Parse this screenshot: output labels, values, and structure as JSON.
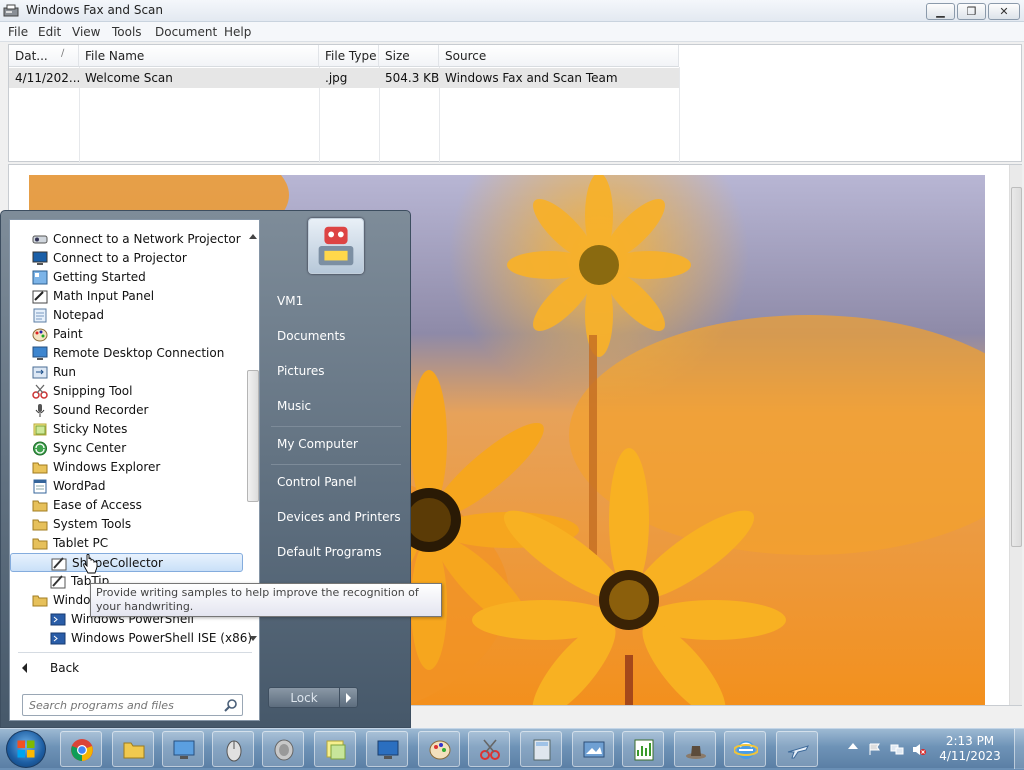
{
  "window": {
    "title": "Windows Fax and Scan",
    "menu": [
      "File",
      "Edit",
      "View",
      "Tools",
      "Document",
      "Help"
    ]
  },
  "list": {
    "columns": [
      "Dat...",
      "File Name",
      "File Type",
      "Size",
      "Source"
    ],
    "rows": [
      {
        "date": "4/11/202...",
        "file_name": "Welcome Scan",
        "file_type": ".jpg",
        "size": "504.3 KB",
        "source": "Windows Fax and Scan Team"
      }
    ]
  },
  "start_menu": {
    "programs": [
      {
        "label": "Connect to a Network Projector",
        "icon": "network-projector-icon"
      },
      {
        "label": "Connect to a Projector",
        "icon": "projector-icon"
      },
      {
        "label": "Getting Started",
        "icon": "getting-started-icon"
      },
      {
        "label": "Math Input Panel",
        "icon": "math-input-icon"
      },
      {
        "label": "Notepad",
        "icon": "notepad-icon"
      },
      {
        "label": "Paint",
        "icon": "paint-icon"
      },
      {
        "label": "Remote Desktop Connection",
        "icon": "remote-desktop-icon"
      },
      {
        "label": "Run",
        "icon": "run-icon"
      },
      {
        "label": "Snipping Tool",
        "icon": "scissors-icon"
      },
      {
        "label": "Sound Recorder",
        "icon": "microphone-icon"
      },
      {
        "label": "Sticky Notes",
        "icon": "sticky-note-icon"
      },
      {
        "label": "Sync Center",
        "icon": "sync-icon"
      },
      {
        "label": "Windows Explorer",
        "icon": "explorer-icon"
      },
      {
        "label": "WordPad",
        "icon": "wordpad-icon"
      },
      {
        "label": "Ease of Access",
        "icon": "folder-icon"
      },
      {
        "label": "System Tools",
        "icon": "folder-icon"
      },
      {
        "label": "Tablet PC",
        "icon": "folder-icon"
      },
      {
        "label": "ShapeCollector",
        "icon": "pen-icon"
      },
      {
        "label": "TabTip",
        "icon": "pen-icon"
      },
      {
        "label": "Windows PowerShell",
        "icon": "folder-icon"
      },
      {
        "label": "Windows PowerShell",
        "icon": "powershell-icon"
      },
      {
        "label": "Windows PowerShell ISE (x86)",
        "icon": "powershell-icon"
      }
    ],
    "back_label": "Back",
    "search_placeholder": "Search programs and files",
    "right_links": [
      "VM1",
      "Documents",
      "Pictures",
      "Music",
      "My Computer",
      "Control Panel",
      "Devices and Printers",
      "Default Programs"
    ],
    "lock_label": "Lock"
  },
  "tooltip": {
    "text": "Provide writing samples to help improve the recognition of your handwriting."
  },
  "taskbar": {
    "buttons": [
      "chrome-icon",
      "explorer-folder-icon",
      "remote-desktop-icon",
      "mouse-icon",
      "speaker-icon",
      "sticky-notes-icon",
      "computer-icon",
      "paint-palette-icon",
      "snipping-icon",
      "calculator-icon",
      "screenshot-icon",
      "chart-icon",
      "hat-icon",
      "internet-explorer-icon",
      "airplane-icon"
    ],
    "time": "2:13 PM",
    "date": "4/11/2023"
  }
}
